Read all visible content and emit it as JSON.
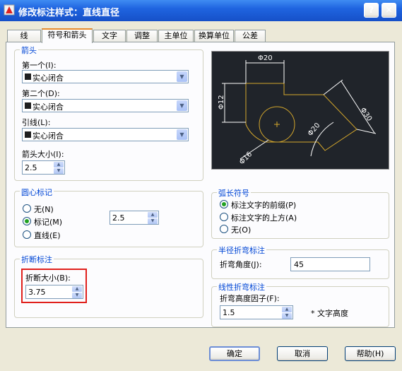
{
  "window": {
    "title": "修改标注样式：直线直径"
  },
  "tabs": [
    {
      "label": "线",
      "active": false
    },
    {
      "label": "符号和箭头",
      "active": true
    },
    {
      "label": "文字",
      "active": false
    },
    {
      "label": "调整",
      "active": false
    },
    {
      "label": "主单位",
      "active": false
    },
    {
      "label": "换算单位",
      "active": false
    },
    {
      "label": "公差",
      "active": false
    }
  ],
  "arrowheads": {
    "title": "箭头",
    "first_label": "第一个(I):",
    "first_value": "实心闭合",
    "second_label": "第二个(D):",
    "second_value": "实心闭合",
    "leader_label": "引线(L):",
    "leader_value": "实心闭合",
    "size_label": "箭头大小(I):",
    "size_value": "2.5"
  },
  "preview": {
    "dim_top": "Φ20",
    "dim_left": "Φ12",
    "dim_diag": "Φ30",
    "dim_arc": "Φ20",
    "dim_small": "Φ16"
  },
  "center_marks": {
    "title": "圆心标记",
    "none_label": "无(N)",
    "mark_label": "标记(M)",
    "line_label": "直线(E)",
    "selected": "mark",
    "size_value": "2.5"
  },
  "arc_length": {
    "title": "弧长符号",
    "prefix_label": "标注文字的前缀(P)",
    "above_label": "标注文字的上方(A)",
    "none_label": "无(O)",
    "selected": "prefix"
  },
  "break": {
    "title": "折断标注",
    "size_label": "折断大小(B):",
    "size_value": "3.75"
  },
  "radius_jog": {
    "title": "半径折弯标注",
    "angle_label": "折弯角度(J):",
    "angle_value": "45"
  },
  "linear_jog": {
    "title": "线性折弯标注",
    "factor_label": "折弯高度因子(F):",
    "factor_value": "1.5",
    "unit_label": "* 文字高度"
  },
  "buttons": {
    "ok": "确定",
    "cancel": "取消",
    "help": "帮助(H)"
  },
  "colors": {
    "titlebar": "#1f64e0",
    "group_title": "#0046d5",
    "preview_bg": "#20242a",
    "highlight": "#e0201c",
    "dim_line": "#ffffff",
    "object_line": "#d4a72c"
  }
}
